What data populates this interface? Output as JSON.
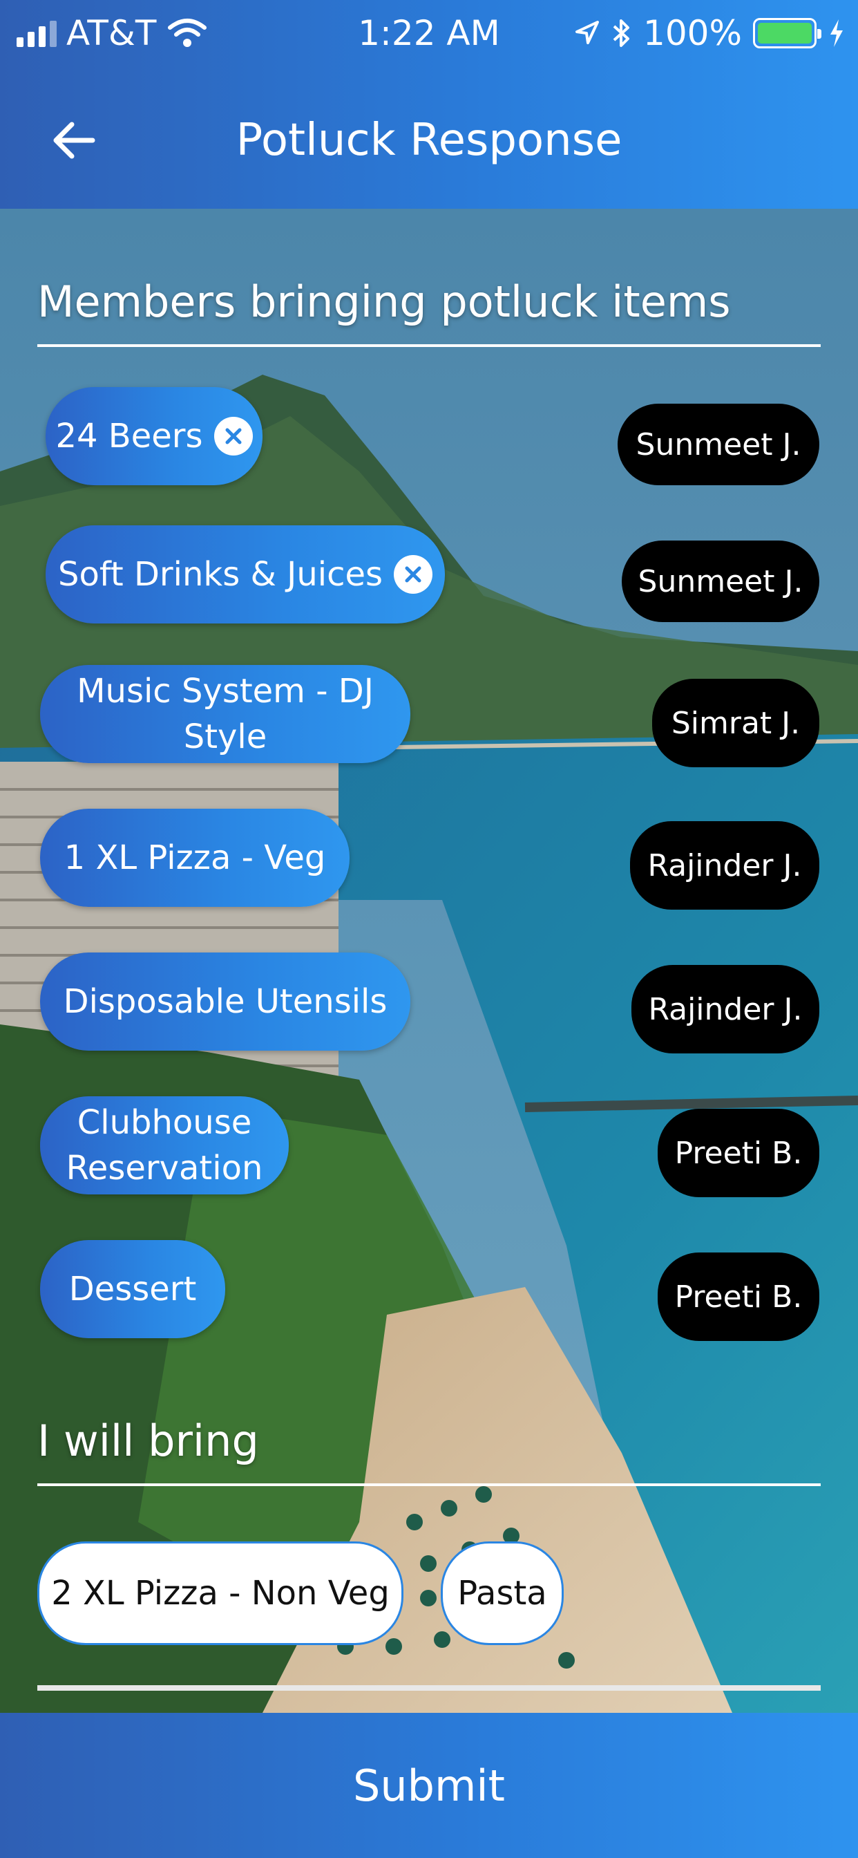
{
  "status_bar": {
    "carrier": "AT&T",
    "time": "1:22 AM",
    "battery": "100%"
  },
  "header": {
    "title": "Potluck Response"
  },
  "members_section": {
    "title": "Members bringing potluck items",
    "items": [
      {
        "item": "24 Beers",
        "member": "Sunmeet J.",
        "removable": true
      },
      {
        "item": "Soft Drinks & Juices",
        "member": "Sunmeet J.",
        "removable": true
      },
      {
        "item": "Music System - DJ Style",
        "member": "Simrat J.",
        "removable": false
      },
      {
        "item": "1 XL Pizza - Veg",
        "member": "Rajinder J.",
        "removable": false
      },
      {
        "item": "Disposable Utensils",
        "member": "Rajinder J.",
        "removable": false
      },
      {
        "item": "Clubhouse Reservation",
        "member": "Preeti B.",
        "removable": false
      },
      {
        "item": "Dessert",
        "member": "Preeti B.",
        "removable": false
      }
    ]
  },
  "bring_section": {
    "title": "I will bring",
    "items": [
      "2 XL Pizza - Non Veg",
      "Pasta"
    ]
  },
  "submit_label": "Submit",
  "colors": {
    "accent": "#2a86e3",
    "member_bg": "#000000",
    "battery": "#4cd964"
  }
}
